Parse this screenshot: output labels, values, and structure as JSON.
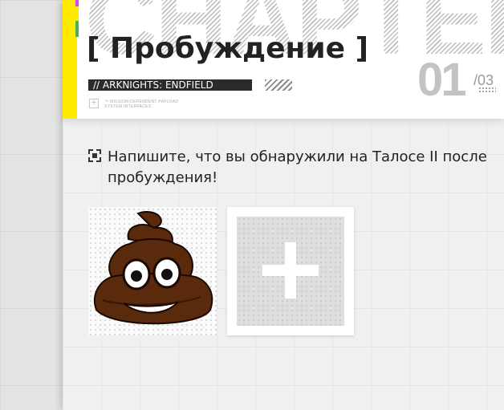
{
  "header": {
    "background_word": "CHAPTER",
    "title": "[ Пробуждение ]",
    "subtitle": "// ARKNIGHTS: ENDFIELD",
    "chapter_number": "01",
    "chapter_total": "/03",
    "meta_line_1": "™ MISSION-DEPENDENT PAYLOAD",
    "meta_line_2": "SYSTEM INTERFACES",
    "accent_color": "#ffea00"
  },
  "content": {
    "question_icon": "focus-frame-icon",
    "question": "Напишите, что вы обнаружили на Талосе II после пробуждения!",
    "uploaded_image": "pile-of-poo-emoji",
    "add_button_icon": "plus-icon"
  }
}
